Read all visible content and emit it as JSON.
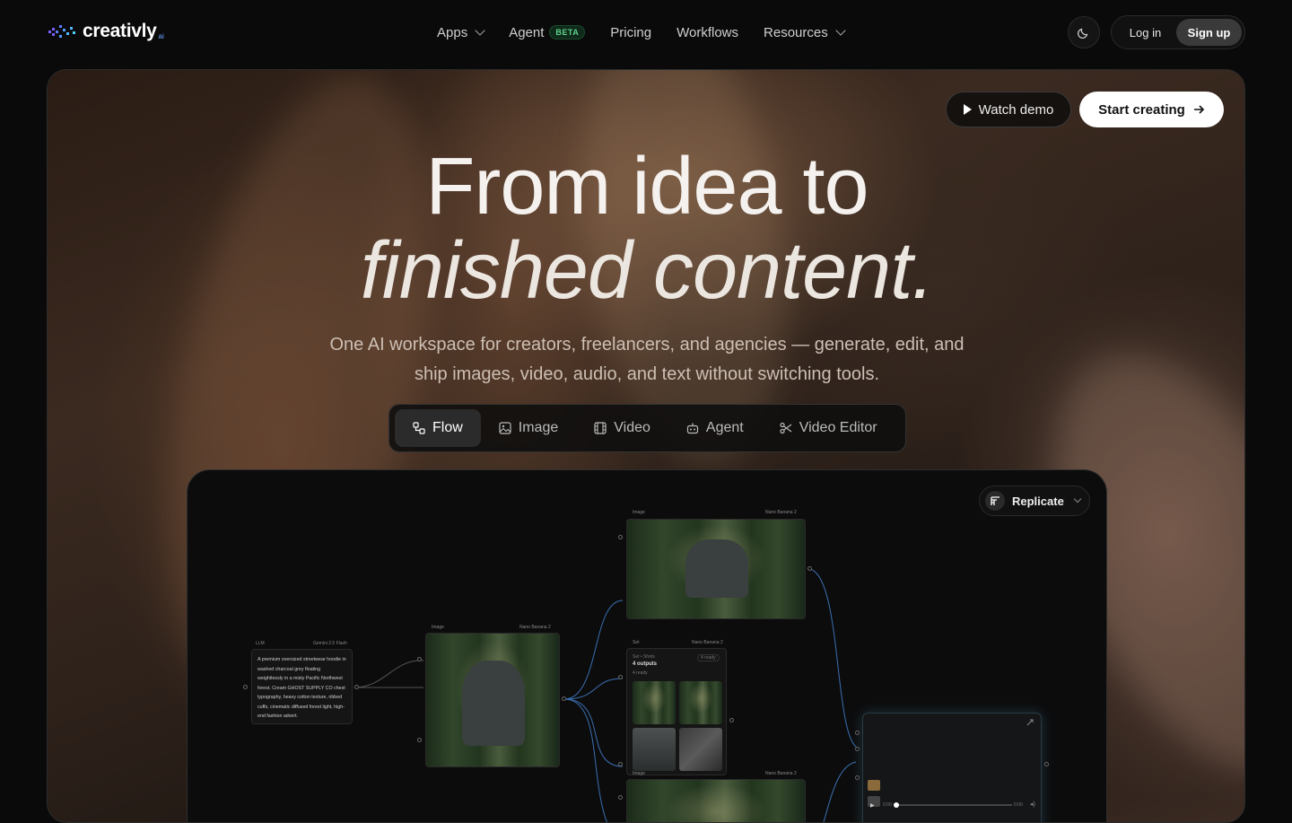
{
  "brand": {
    "name": "creativly",
    "suffix": "ai"
  },
  "nav": {
    "items": [
      {
        "label": "Apps",
        "dropdown": true
      },
      {
        "label": "Agent",
        "badge": "BETA"
      },
      {
        "label": "Pricing"
      },
      {
        "label": "Workflows"
      },
      {
        "label": "Resources",
        "dropdown": true
      }
    ],
    "theme_icon": "moon-icon",
    "login": "Log in",
    "signup": "Sign up"
  },
  "hero": {
    "watch_demo": "Watch demo",
    "start_creating": "Start creating",
    "title_line1": "From idea to",
    "title_line2": "finished content.",
    "subtitle": "One AI workspace for creators, freelancers, and agencies — generate, edit, and ship images, video, audio, and text without switching tools.",
    "tabs": [
      {
        "label": "Flow",
        "icon": "flow-icon",
        "active": true
      },
      {
        "label": "Image",
        "icon": "image-icon"
      },
      {
        "label": "Video",
        "icon": "film-icon"
      },
      {
        "label": "Agent",
        "icon": "robot-icon"
      },
      {
        "label": "Video Editor",
        "icon": "scissors-icon"
      }
    ]
  },
  "canvas": {
    "provider": "Replicate",
    "llm_node": {
      "label": "LLM",
      "model": "Gemini 2.5 Flash",
      "prompt": "A premium oversized streetwear hoodie in washed charcoal grey floating weightlessly in a misty Pacific Northwest forest. Cream GHOST SUPPLY CO chest typography, heavy cotton texture, ribbed cuffs, cinematic diffused forest light, high-end fashion advert."
    },
    "image_node_1": {
      "label": "Image",
      "model": "Nano Banana 2"
    },
    "image_node_2": {
      "label": "Image",
      "model": "Nano Banana 2"
    },
    "set_node": {
      "label": "Set",
      "model": "Nano Banana 2",
      "header": "Set • Shots",
      "title": "4 outputs",
      "count": "4 ready",
      "ready_badge": "4 ready"
    },
    "image_node_3": {
      "label": "Image",
      "model": "Nano Banana 2"
    },
    "video_player": {
      "time_start": "0:00",
      "time_end": "0:00"
    }
  },
  "colors": {
    "accent_green": "#5fd08a",
    "brand_blue": "#6aa0ff",
    "edge_blue": "#3a6fb0"
  }
}
